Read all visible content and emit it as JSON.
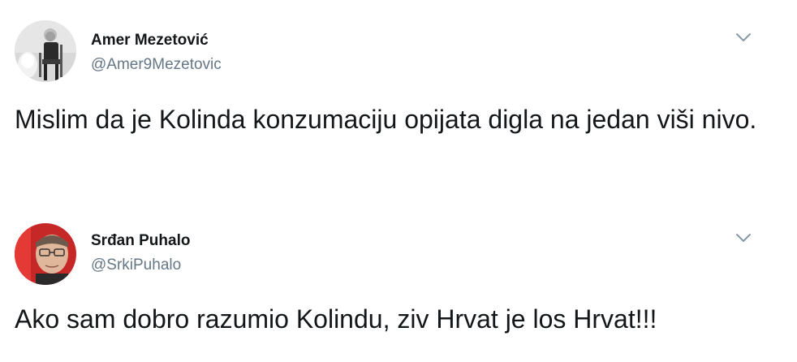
{
  "tweets": [
    {
      "name": "Amer Mezetović",
      "handle": "@Amer9Mezetovic",
      "text": "Mislim da je Kolinda konzumaciju opijata digla na jedan viši nivo.",
      "avatar_icon": "avatar-photo-icon",
      "menu_icon": "chevron-down-icon"
    },
    {
      "name": "Srđan Puhalo",
      "handle": "@SrkiPuhalo",
      "text": "Ako sam dobro razumio Kolindu, ziv Hrvat je los Hrvat!!!",
      "avatar_icon": "avatar-photo-icon",
      "menu_icon": "chevron-down-icon"
    }
  ],
  "colors": {
    "text": "#14171a",
    "secondary": "#657786",
    "caret": "#8899a6"
  }
}
